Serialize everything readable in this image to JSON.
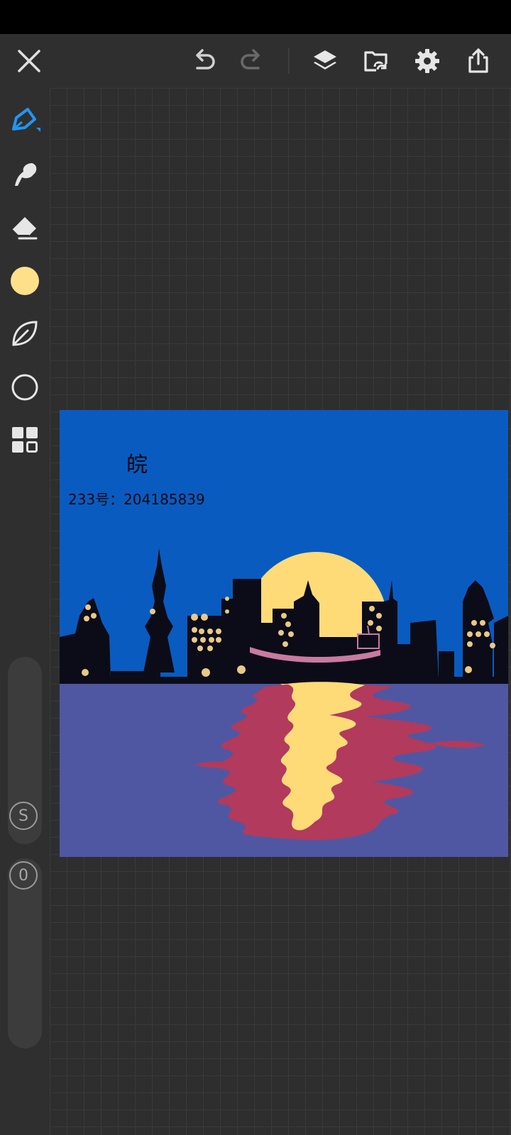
{
  "toolbar": {
    "close_icon": "close-icon",
    "undo_icon": "undo-icon",
    "redo_icon": "redo-icon",
    "layers_icon": "layers-icon",
    "import_icon": "import-file-icon",
    "settings_icon": "gear-icon",
    "share_icon": "share-icon"
  },
  "tools": {
    "active": "pen",
    "accent_color": "#2196f3",
    "current_color": "#ffe08a",
    "items": [
      "pen-icon",
      "smudge-icon",
      "eraser-icon",
      "color-swatch",
      "leaf-icon",
      "shape-circle-icon",
      "grid-icon"
    ]
  },
  "sliders": {
    "size_label": "S",
    "opacity_label": "0"
  },
  "canvas": {
    "title": "皖",
    "id_text": "233号：204185839",
    "colors": {
      "sky": "#0a5bc0",
      "water": "#4f57a3",
      "sun": "#ffdb78",
      "reflection": "#b23a5c",
      "skyline": "#0b0c18",
      "lights": "#e9c987"
    }
  }
}
